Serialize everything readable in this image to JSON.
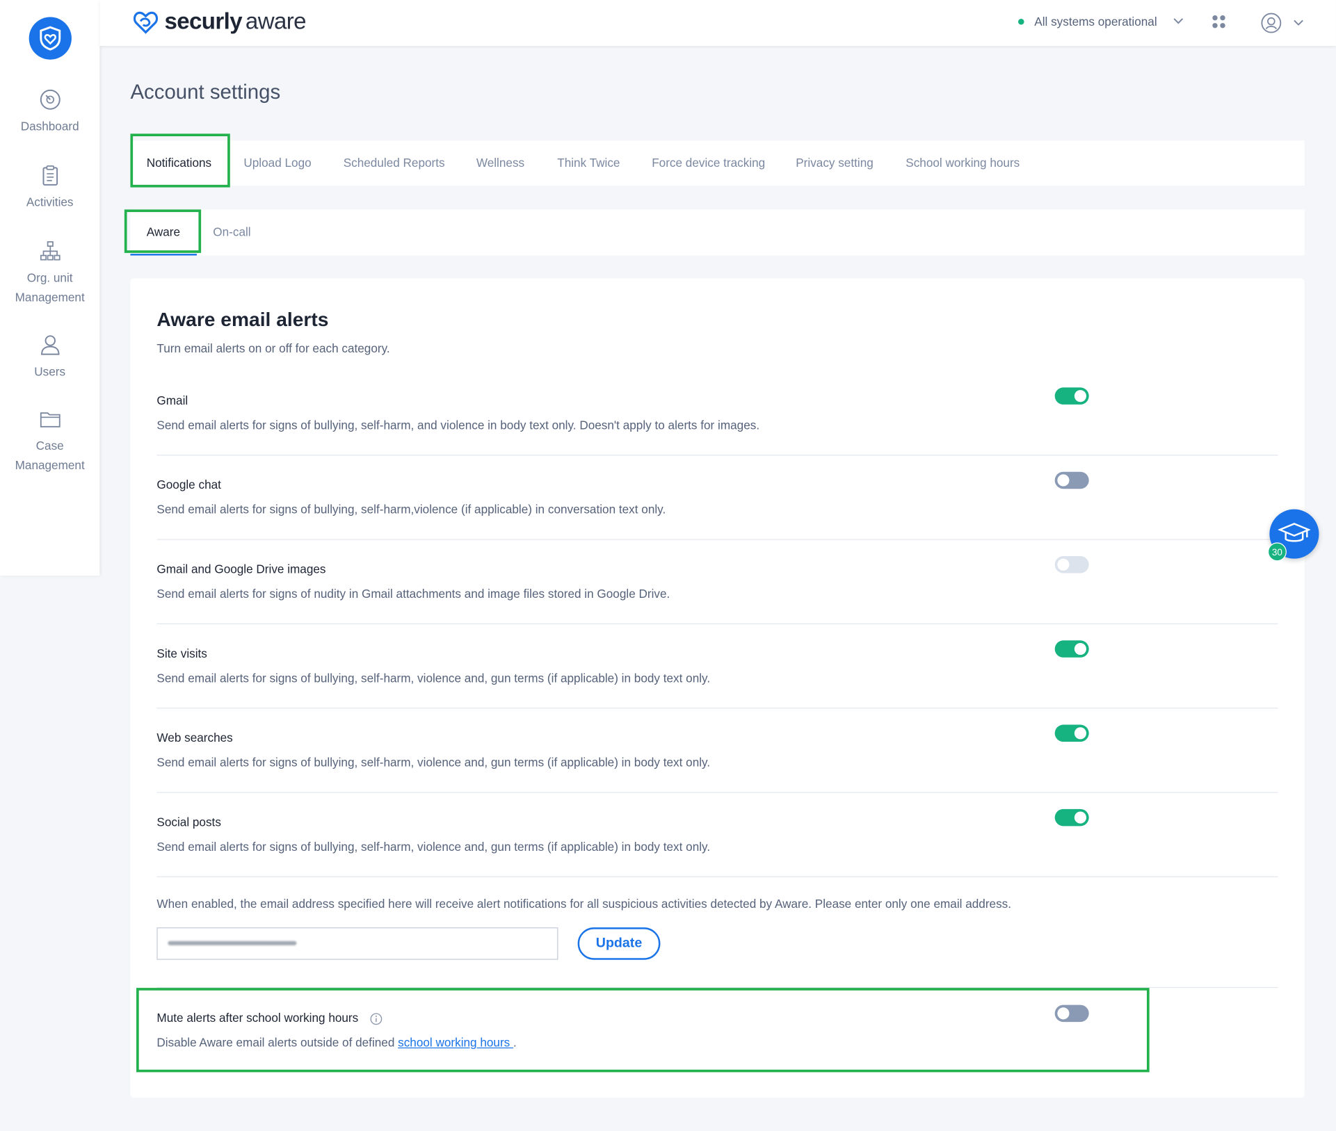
{
  "brand": {
    "name_bold": "securly",
    "name_light": "aware"
  },
  "header": {
    "status_text": "All systems operational"
  },
  "sidebar": {
    "items": [
      {
        "label": "Dashboard"
      },
      {
        "label": "Activities"
      },
      {
        "label_line1": "Org. unit",
        "label_line2": "Management"
      },
      {
        "label": "Users"
      },
      {
        "label_line1": "Case",
        "label_line2": "Management"
      }
    ]
  },
  "page": {
    "title": "Account settings"
  },
  "tabs": [
    {
      "label": "Notifications",
      "active": true
    },
    {
      "label": "Upload Logo"
    },
    {
      "label": "Scheduled Reports"
    },
    {
      "label": "Wellness"
    },
    {
      "label": "Think Twice"
    },
    {
      "label": "Force device tracking"
    },
    {
      "label": "Privacy setting"
    },
    {
      "label": "School working hours"
    }
  ],
  "subtabs": [
    {
      "label": "Aware",
      "active": true
    },
    {
      "label": "On-call"
    }
  ],
  "card": {
    "title": "Aware email alerts",
    "subtitle": "Turn email alerts on or off for each category.",
    "alerts": [
      {
        "title": "Gmail",
        "desc": "Send email alerts for signs of bullying, self-harm, and violence in body text only. Doesn't apply to alerts for images.",
        "state": "on"
      },
      {
        "title": "Google chat",
        "desc": "Send email alerts for signs of bullying, self-harm,violence (if applicable) in conversation text only.",
        "state": "off"
      },
      {
        "title": "Gmail and Google Drive images",
        "desc": "Send email alerts for signs of nudity in Gmail attachments and image files stored in Google Drive.",
        "state": "disabled"
      },
      {
        "title": "Site visits",
        "desc": "Send email alerts for signs of bullying, self-harm, violence and, gun terms (if applicable) in body text only.",
        "state": "on"
      },
      {
        "title": "Web searches",
        "desc": "Send email alerts for signs of bullying, self-harm, violence and, gun terms (if applicable) in body text only.",
        "state": "on"
      },
      {
        "title": "Social posts",
        "desc": "Send email alerts for signs of bullying, self-harm, violence and, gun terms (if applicable) in body text only.",
        "state": "on"
      }
    ],
    "email_note": "When enabled, the email address specified here will receive alert notifications for all suspicious activities detected by Aware. Please enter only one email address.",
    "update_label": "Update",
    "mute": {
      "title": "Mute alerts after school working hours",
      "desc_prefix": "Disable Aware email alerts outside of defined ",
      "link": "school working hours ",
      "desc_suffix": ".",
      "state": "off"
    }
  },
  "fab": {
    "badge": "30"
  },
  "colors": {
    "accent": "#1a73e8",
    "toggle_on": "#16b380",
    "highlight": "#22b14c"
  }
}
